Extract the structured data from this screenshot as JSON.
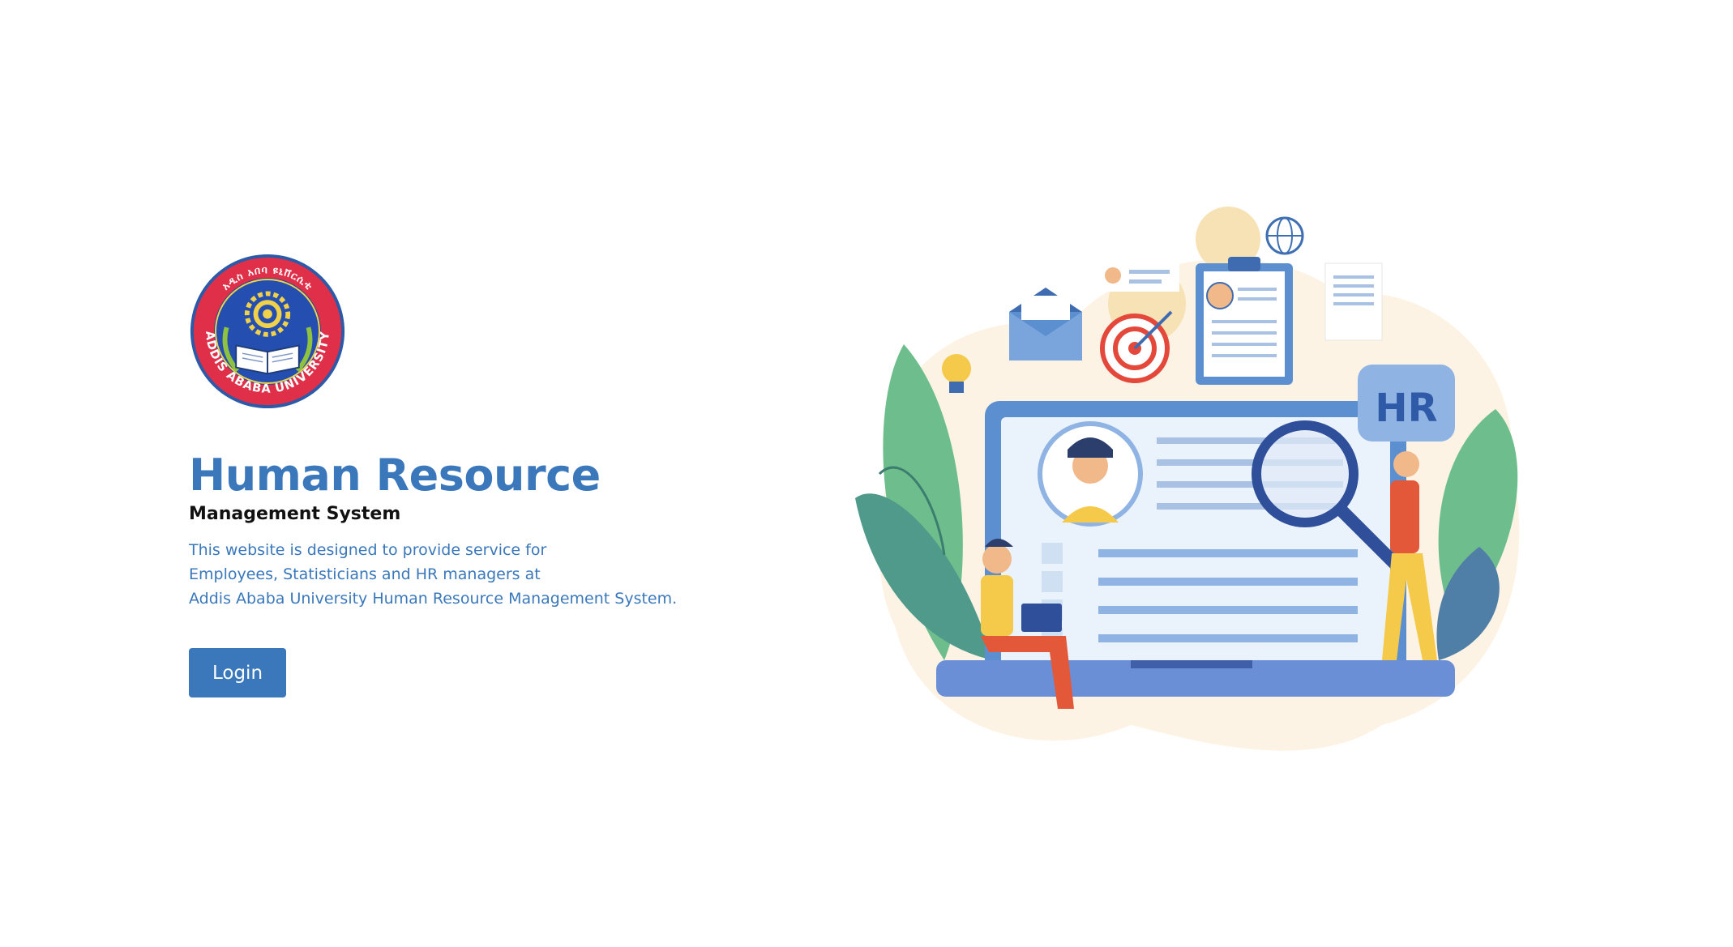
{
  "logo": {
    "text": "Addis Ababa University",
    "amharic_text": "አዲስ አበባ ዩኒቨርሲቲ",
    "colors": {
      "ring": "#e02f48",
      "inner": "#1f4aa0",
      "gold": "#e8c83a"
    }
  },
  "hero": {
    "title": "Human Resource",
    "subtitle": "Management System",
    "description_lines": [
      "This website is designed to provide service for",
      "Employees, Statisticians and HR managers at",
      "Addis Ababa University Human Resource Management System."
    ]
  },
  "actions": {
    "login_label": "Login"
  },
  "illustration": {
    "badge_text": "HR"
  },
  "colors": {
    "primary": "#3a78bb",
    "text_dark": "#111111",
    "background": "#ffffff"
  }
}
